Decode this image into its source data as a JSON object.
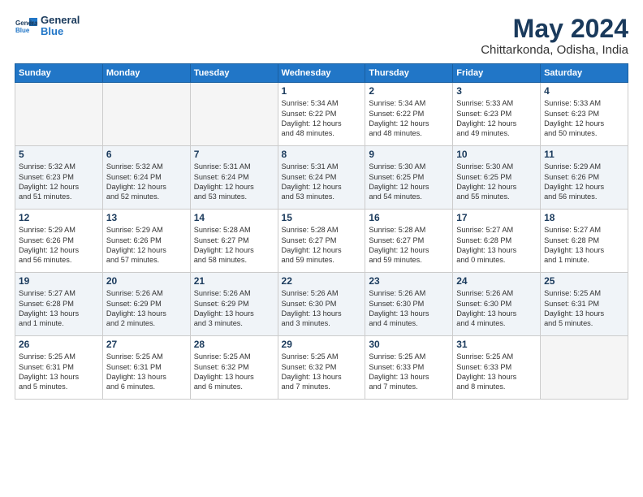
{
  "header": {
    "logo": {
      "line1": "General",
      "line2": "Blue"
    },
    "title": "May 2024",
    "location": "Chittarkonda, Odisha, India"
  },
  "weekdays": [
    "Sunday",
    "Monday",
    "Tuesday",
    "Wednesday",
    "Thursday",
    "Friday",
    "Saturday"
  ],
  "weeks": [
    [
      {
        "day": "",
        "info": ""
      },
      {
        "day": "",
        "info": ""
      },
      {
        "day": "",
        "info": ""
      },
      {
        "day": "1",
        "info": "Sunrise: 5:34 AM\nSunset: 6:22 PM\nDaylight: 12 hours\nand 48 minutes."
      },
      {
        "day": "2",
        "info": "Sunrise: 5:34 AM\nSunset: 6:22 PM\nDaylight: 12 hours\nand 48 minutes."
      },
      {
        "day": "3",
        "info": "Sunrise: 5:33 AM\nSunset: 6:23 PM\nDaylight: 12 hours\nand 49 minutes."
      },
      {
        "day": "4",
        "info": "Sunrise: 5:33 AM\nSunset: 6:23 PM\nDaylight: 12 hours\nand 50 minutes."
      }
    ],
    [
      {
        "day": "5",
        "info": "Sunrise: 5:32 AM\nSunset: 6:23 PM\nDaylight: 12 hours\nand 51 minutes."
      },
      {
        "day": "6",
        "info": "Sunrise: 5:32 AM\nSunset: 6:24 PM\nDaylight: 12 hours\nand 52 minutes."
      },
      {
        "day": "7",
        "info": "Sunrise: 5:31 AM\nSunset: 6:24 PM\nDaylight: 12 hours\nand 53 minutes."
      },
      {
        "day": "8",
        "info": "Sunrise: 5:31 AM\nSunset: 6:24 PM\nDaylight: 12 hours\nand 53 minutes."
      },
      {
        "day": "9",
        "info": "Sunrise: 5:30 AM\nSunset: 6:25 PM\nDaylight: 12 hours\nand 54 minutes."
      },
      {
        "day": "10",
        "info": "Sunrise: 5:30 AM\nSunset: 6:25 PM\nDaylight: 12 hours\nand 55 minutes."
      },
      {
        "day": "11",
        "info": "Sunrise: 5:29 AM\nSunset: 6:26 PM\nDaylight: 12 hours\nand 56 minutes."
      }
    ],
    [
      {
        "day": "12",
        "info": "Sunrise: 5:29 AM\nSunset: 6:26 PM\nDaylight: 12 hours\nand 56 minutes."
      },
      {
        "day": "13",
        "info": "Sunrise: 5:29 AM\nSunset: 6:26 PM\nDaylight: 12 hours\nand 57 minutes."
      },
      {
        "day": "14",
        "info": "Sunrise: 5:28 AM\nSunset: 6:27 PM\nDaylight: 12 hours\nand 58 minutes."
      },
      {
        "day": "15",
        "info": "Sunrise: 5:28 AM\nSunset: 6:27 PM\nDaylight: 12 hours\nand 59 minutes."
      },
      {
        "day": "16",
        "info": "Sunrise: 5:28 AM\nSunset: 6:27 PM\nDaylight: 12 hours\nand 59 minutes."
      },
      {
        "day": "17",
        "info": "Sunrise: 5:27 AM\nSunset: 6:28 PM\nDaylight: 13 hours\nand 0 minutes."
      },
      {
        "day": "18",
        "info": "Sunrise: 5:27 AM\nSunset: 6:28 PM\nDaylight: 13 hours\nand 1 minute."
      }
    ],
    [
      {
        "day": "19",
        "info": "Sunrise: 5:27 AM\nSunset: 6:28 PM\nDaylight: 13 hours\nand 1 minute."
      },
      {
        "day": "20",
        "info": "Sunrise: 5:26 AM\nSunset: 6:29 PM\nDaylight: 13 hours\nand 2 minutes."
      },
      {
        "day": "21",
        "info": "Sunrise: 5:26 AM\nSunset: 6:29 PM\nDaylight: 13 hours\nand 3 minutes."
      },
      {
        "day": "22",
        "info": "Sunrise: 5:26 AM\nSunset: 6:30 PM\nDaylight: 13 hours\nand 3 minutes."
      },
      {
        "day": "23",
        "info": "Sunrise: 5:26 AM\nSunset: 6:30 PM\nDaylight: 13 hours\nand 4 minutes."
      },
      {
        "day": "24",
        "info": "Sunrise: 5:26 AM\nSunset: 6:30 PM\nDaylight: 13 hours\nand 4 minutes."
      },
      {
        "day": "25",
        "info": "Sunrise: 5:25 AM\nSunset: 6:31 PM\nDaylight: 13 hours\nand 5 minutes."
      }
    ],
    [
      {
        "day": "26",
        "info": "Sunrise: 5:25 AM\nSunset: 6:31 PM\nDaylight: 13 hours\nand 5 minutes."
      },
      {
        "day": "27",
        "info": "Sunrise: 5:25 AM\nSunset: 6:31 PM\nDaylight: 13 hours\nand 6 minutes."
      },
      {
        "day": "28",
        "info": "Sunrise: 5:25 AM\nSunset: 6:32 PM\nDaylight: 13 hours\nand 6 minutes."
      },
      {
        "day": "29",
        "info": "Sunrise: 5:25 AM\nSunset: 6:32 PM\nDaylight: 13 hours\nand 7 minutes."
      },
      {
        "day": "30",
        "info": "Sunrise: 5:25 AM\nSunset: 6:33 PM\nDaylight: 13 hours\nand 7 minutes."
      },
      {
        "day": "31",
        "info": "Sunrise: 5:25 AM\nSunset: 6:33 PM\nDaylight: 13 hours\nand 8 minutes."
      },
      {
        "day": "",
        "info": ""
      }
    ]
  ]
}
